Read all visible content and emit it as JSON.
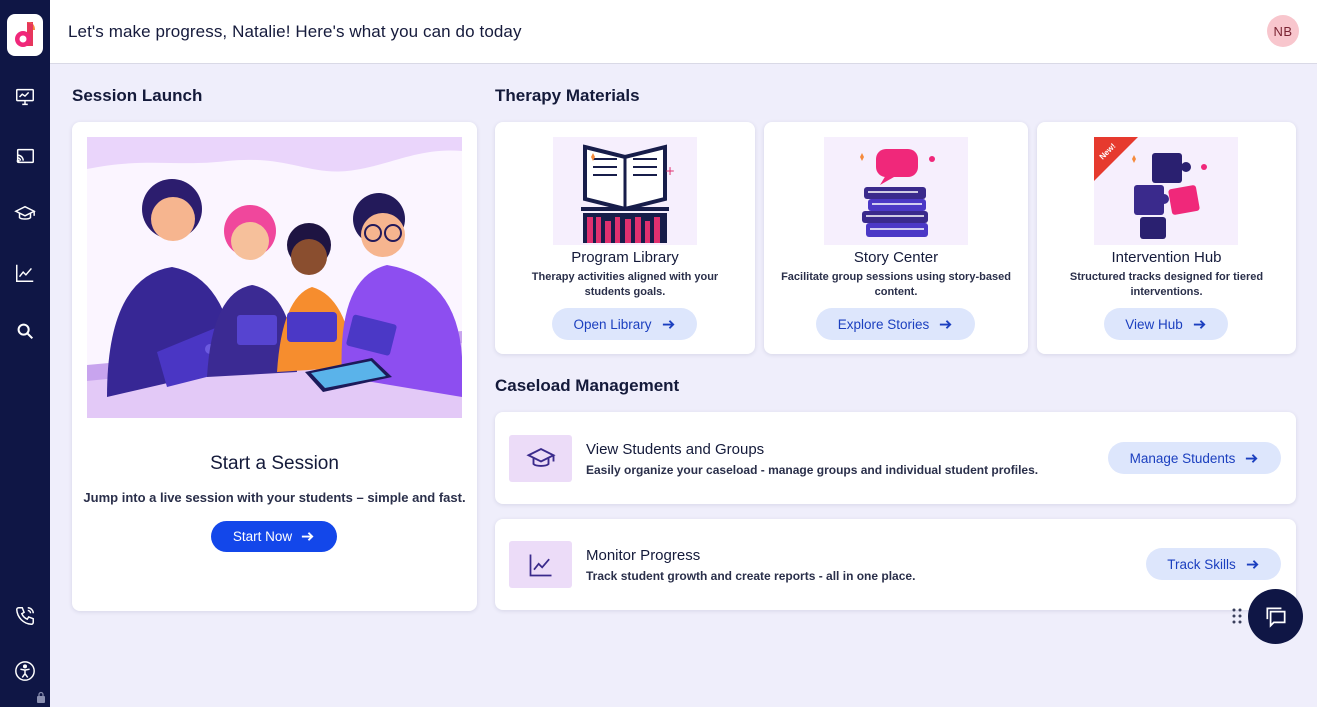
{
  "header": {
    "greeting": "Let's make progress, Natalie! Here's what you can do today",
    "avatar_initials": "NB"
  },
  "sidebar": {
    "items": [
      {
        "name": "presentation-icon"
      },
      {
        "name": "cast-icon"
      },
      {
        "name": "graduation-cap-icon"
      },
      {
        "name": "trending-up-icon"
      },
      {
        "name": "search-icon"
      },
      {
        "name": "phone-icon"
      },
      {
        "name": "accessibility-icon"
      }
    ]
  },
  "session_launch": {
    "heading": "Session Launch",
    "title": "Start a Session",
    "description": "Jump into a live session with your students – simple and fast.",
    "button_label": "Start Now"
  },
  "therapy_materials": {
    "heading": "Therapy Materials",
    "cards": [
      {
        "title": "Program Library",
        "description": "Therapy activities aligned with your students goals.",
        "button_label": "Open Library",
        "icon": "book-icon"
      },
      {
        "title": "Story Center",
        "description": "Facilitate group sessions using story-based content.",
        "button_label": "Explore Stories",
        "icon": "books-speech-icon"
      },
      {
        "title": "Intervention Hub",
        "description": "Structured tracks designed for tiered interventions.",
        "button_label": "View Hub",
        "icon": "puzzle-icon",
        "badge": "New!"
      }
    ]
  },
  "caseload": {
    "heading": "Caseload Management",
    "rows": [
      {
        "title": "View Students and Groups",
        "description": "Easily organize your caseload - manage groups and individual student profiles.",
        "button_label": "Manage Students",
        "icon": "graduation-cap-icon"
      },
      {
        "title": "Monitor Progress",
        "description": "Track student growth and create reports - all in one place.",
        "button_label": "Track Skills",
        "icon": "line-chart-icon"
      }
    ]
  },
  "colors": {
    "sidebar": "#0f1645",
    "primary": "#1347ea",
    "soft_button": "#dde6fc",
    "accent_pink": "#f0287a",
    "purple": "#3a2a8c"
  }
}
